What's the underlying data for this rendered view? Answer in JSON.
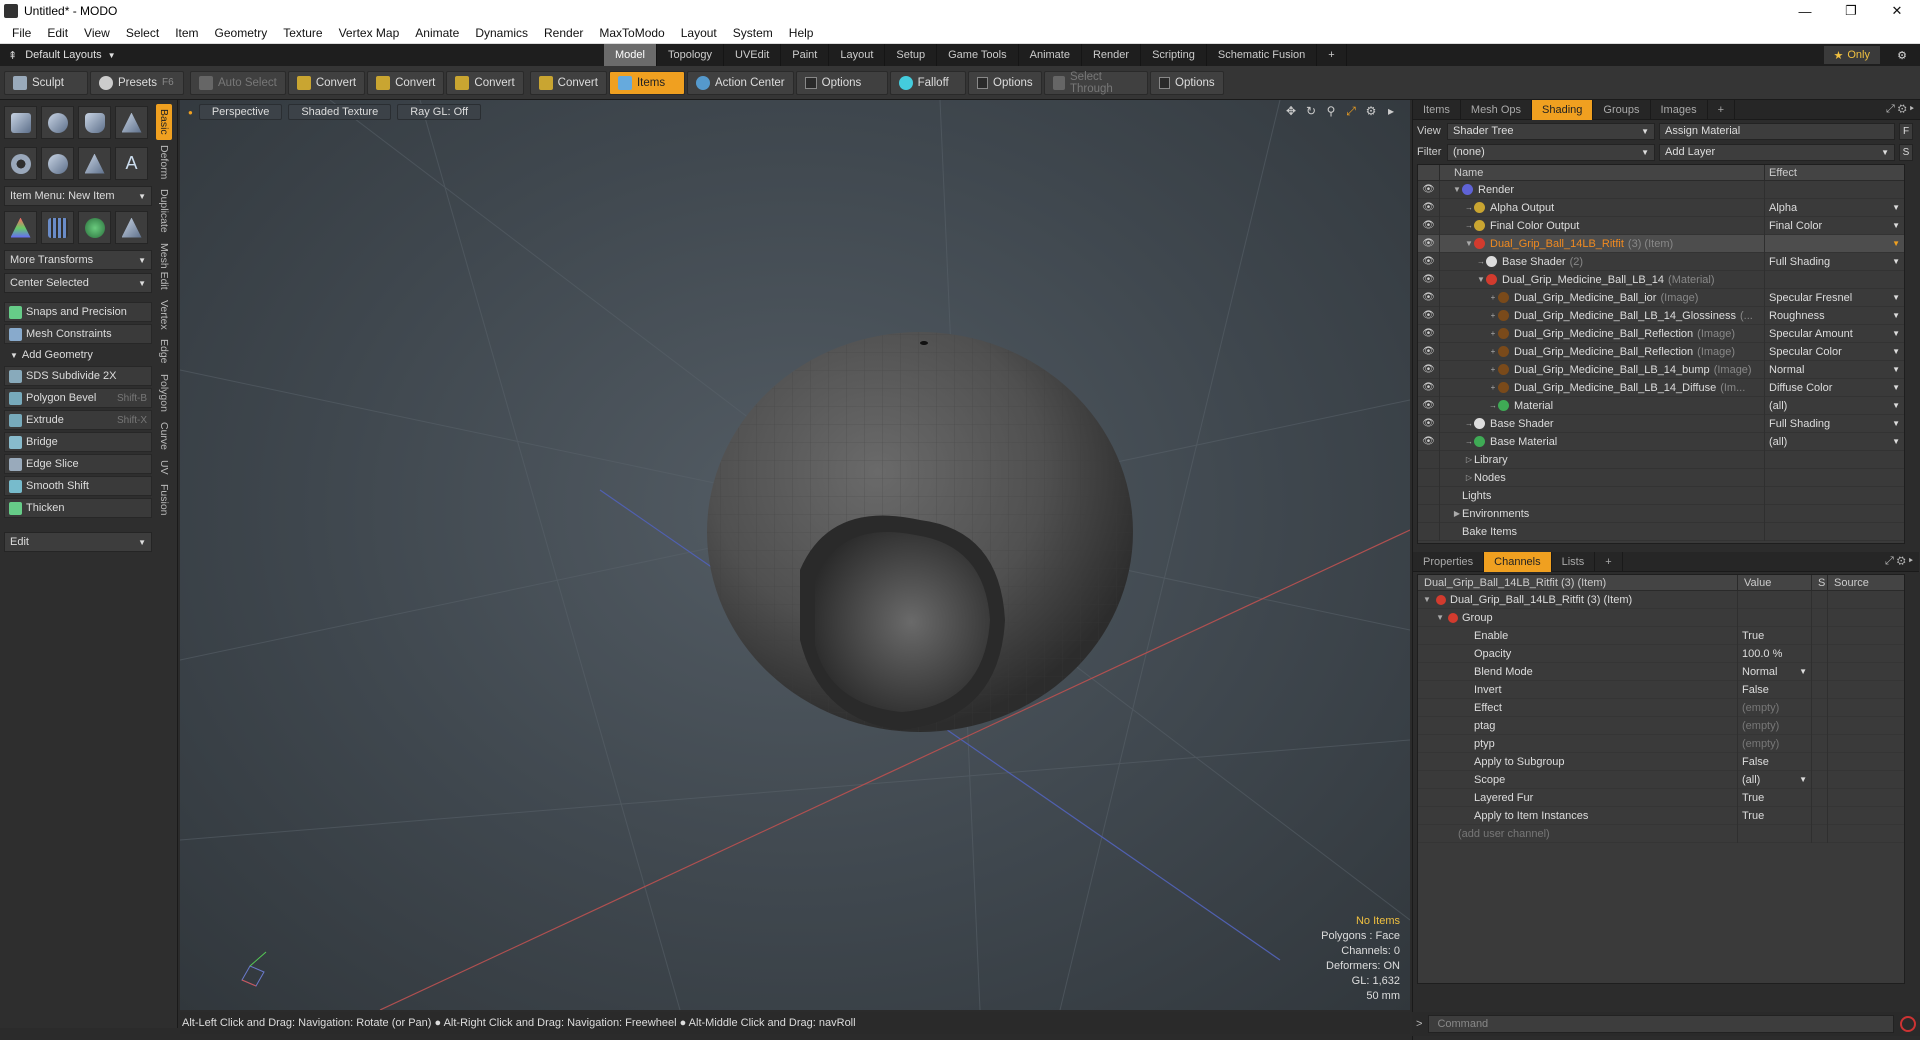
{
  "window": {
    "title": "Untitled* - MODO",
    "controls": [
      "—",
      "❐",
      "✕"
    ]
  },
  "menu": [
    "File",
    "Edit",
    "View",
    "Select",
    "Item",
    "Geometry",
    "Texture",
    "Vertex Map",
    "Animate",
    "Dynamics",
    "Render",
    "MaxToModo",
    "Layout",
    "System",
    "Help"
  ],
  "layout_bar": {
    "default_layouts": "Default Layouts",
    "tabs": [
      {
        "label": "Model",
        "active": true
      },
      {
        "label": "Topology"
      },
      {
        "label": "UVEdit"
      },
      {
        "label": "Paint"
      },
      {
        "label": "Layout"
      },
      {
        "label": "Setup"
      },
      {
        "label": "Game Tools"
      },
      {
        "label": "Animate"
      },
      {
        "label": "Render"
      },
      {
        "label": "Scripting"
      },
      {
        "label": "Schematic Fusion"
      }
    ],
    "plus": "+",
    "only_label": "Only"
  },
  "toolbar": {
    "sculpt": "Sculpt",
    "presets": "Presets",
    "presets_shortcut": "F6",
    "auto_select": "Auto Select",
    "convert": "Convert",
    "items": "Items",
    "action_center": "Action Center",
    "options": "Options",
    "falloff": "Falloff",
    "select_through": "Select Through"
  },
  "left_panel": {
    "item_menu": "Item Menu: New Item",
    "more_transforms": "More Transforms",
    "center_selected": "Center Selected",
    "snaps": "Snaps and Precision",
    "mesh_constraints": "Mesh Constraints",
    "add_geometry": "Add Geometry",
    "tools": [
      {
        "label": "SDS Subdivide 2X",
        "shortcut": ""
      },
      {
        "label": "Polygon Bevel",
        "shortcut": "Shift-B"
      },
      {
        "label": "Extrude",
        "shortcut": "Shift-X"
      },
      {
        "label": "Bridge",
        "shortcut": ""
      },
      {
        "label": "Edge Slice",
        "shortcut": ""
      },
      {
        "label": "Smooth Shift",
        "shortcut": ""
      },
      {
        "label": "Thicken",
        "shortcut": ""
      }
    ],
    "edit": "Edit",
    "vertical_tabs": [
      "Basic",
      "Deform",
      "Duplicate",
      "Mesh Edit",
      "Vertex",
      "Edge",
      "Polygon",
      "Curve",
      "UV",
      "Fusion"
    ]
  },
  "viewport": {
    "view_mode": "Perspective",
    "shading": "Shaded Texture",
    "raygl": "Ray GL: Off",
    "stats": {
      "items": "No Items",
      "polygons": "Polygons : Face",
      "channels": "Channels: 0",
      "deformers": "Deformers: ON",
      "gl": "GL: 1,632",
      "units": "50 mm"
    }
  },
  "statusbar": "Alt-Left Click and Drag: Navigation: Rotate (or Pan) ● Alt-Right Click and Drag: Navigation: Freewheel ● Alt-Middle Click and Drag: navRoll",
  "shading_panel": {
    "tabs": [
      {
        "label": "Items"
      },
      {
        "label": "Mesh Ops"
      },
      {
        "label": "Shading",
        "active": true
      },
      {
        "label": "Groups"
      },
      {
        "label": "Images"
      }
    ],
    "view_label": "View",
    "view_value": "Shader Tree",
    "assign_material": "Assign Material",
    "filter_label": "Filter",
    "filter_value": "(none)",
    "add_layer": "Add Layer",
    "f_btn": "F",
    "s_btn": "S",
    "col_name": "Name",
    "col_effect": "Effect",
    "rows": [
      {
        "indent": 1,
        "tw": "▼",
        "icon": "#5f63d6",
        "name": "Render",
        "sub": "",
        "effect": ""
      },
      {
        "indent": 2,
        "tw": "→",
        "icon": "#c9a531",
        "name": "Alpha Output",
        "sub": "",
        "effect": "Alpha"
      },
      {
        "indent": 2,
        "tw": "→",
        "icon": "#c9a531",
        "name": "Final Color Output",
        "sub": "",
        "effect": "Final Color"
      },
      {
        "indent": 2,
        "tw": "▼",
        "icon": "#d23b2e",
        "name": "Dual_Grip_Ball_14LB_Ritfit",
        "sub": "(3) (Item)",
        "effect": "",
        "sel": true
      },
      {
        "indent": 3,
        "tw": "→",
        "icon": "#dddddd",
        "name": "Base Shader",
        "sub": "(2)",
        "effect": "Full Shading"
      },
      {
        "indent": 3,
        "tw": "▼",
        "icon": "#d23b2e",
        "name": "Dual_Grip_Medicine_Ball_LB_14",
        "sub": "(Material)",
        "effect": ""
      },
      {
        "indent": 4,
        "tw": "+",
        "icon": "#7a4a1a",
        "name": "Dual_Grip_Medicine_Ball_ior",
        "sub": "(Image)",
        "effect": "Specular Fresnel"
      },
      {
        "indent": 4,
        "tw": "+",
        "icon": "#7a4a1a",
        "name": "Dual_Grip_Medicine_Ball_LB_14_Glossiness",
        "sub": "(...",
        "effect": "Roughness"
      },
      {
        "indent": 4,
        "tw": "+",
        "icon": "#7a4a1a",
        "name": "Dual_Grip_Medicine_Ball_Reflection",
        "sub": "(Image)",
        "effect": "Specular Amount"
      },
      {
        "indent": 4,
        "tw": "+",
        "icon": "#7a4a1a",
        "name": "Dual_Grip_Medicine_Ball_Reflection",
        "sub": "(Image)",
        "effect": "Specular Color"
      },
      {
        "indent": 4,
        "tw": "+",
        "icon": "#7a4a1a",
        "name": "Dual_Grip_Medicine_Ball_LB_14_bump",
        "sub": "(Image)",
        "effect": "Normal"
      },
      {
        "indent": 4,
        "tw": "+",
        "icon": "#7a4a1a",
        "name": "Dual_Grip_Medicine_Ball_LB_14_Diffuse",
        "sub": "(Im...",
        "effect": "Diffuse Color"
      },
      {
        "indent": 4,
        "tw": "→",
        "icon": "#3faa55",
        "name": "Material",
        "sub": "",
        "effect": "(all)"
      },
      {
        "indent": 2,
        "tw": "→",
        "icon": "#dddddd",
        "name": "Base Shader",
        "sub": "",
        "effect": "Full Shading"
      },
      {
        "indent": 2,
        "tw": "→",
        "icon": "#3faa55",
        "name": "Base Material",
        "sub": "",
        "effect": "(all)"
      },
      {
        "indent": 2,
        "tw": "▷",
        "icon": "",
        "name": "Library",
        "sub": "",
        "effect": "",
        "noeye": true
      },
      {
        "indent": 2,
        "tw": "▷",
        "icon": "",
        "name": "Nodes",
        "sub": "",
        "effect": "",
        "noeye": true
      },
      {
        "indent": 1,
        "tw": "",
        "icon": "",
        "name": "Lights",
        "sub": "",
        "effect": "",
        "noeye": true
      },
      {
        "indent": 1,
        "tw": "▶",
        "icon": "",
        "name": "Environments",
        "sub": "",
        "effect": "",
        "noeye": true
      },
      {
        "indent": 1,
        "tw": "",
        "icon": "",
        "name": "Bake Items",
        "sub": "",
        "effect": "",
        "noeye": true
      }
    ]
  },
  "props_panel": {
    "tabs": [
      {
        "label": "Properties"
      },
      {
        "label": "Channels",
        "active": true
      },
      {
        "label": "Lists"
      }
    ],
    "header_name": "Dual_Grip_Ball_14LB_Ritfit (3) (Item)",
    "col_value": "Value",
    "col_s": "S",
    "col_source": "Source",
    "item": "Dual_Grip_Ball_14LB_Ritfit (3) (Item)",
    "group": "Group",
    "channels": [
      {
        "name": "Enable",
        "value": "True"
      },
      {
        "name": "Opacity",
        "value": "100.0 %"
      },
      {
        "name": "Blend Mode",
        "value": "Normal",
        "dd": true
      },
      {
        "name": "Invert",
        "value": "False"
      },
      {
        "name": "Effect",
        "value": "(empty)",
        "empty": true
      },
      {
        "name": "ptag",
        "value": "(empty)",
        "empty": true
      },
      {
        "name": "ptyp",
        "value": "(empty)",
        "empty": true
      },
      {
        "name": "Apply to Subgroup",
        "value": "False"
      },
      {
        "name": "Scope",
        "value": "(all)",
        "dd": true
      },
      {
        "name": "Layered Fur",
        "value": "True"
      },
      {
        "name": "Apply to Item Instances",
        "value": "True"
      }
    ],
    "add_user_channel": "(add user channel)"
  },
  "command": {
    "placeholder": "Command"
  }
}
